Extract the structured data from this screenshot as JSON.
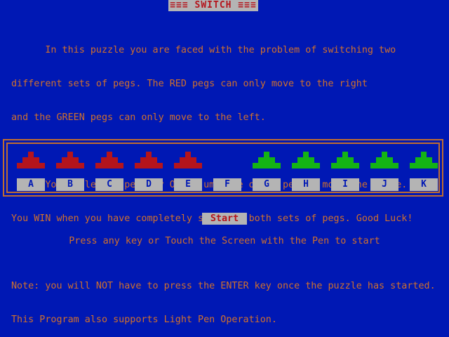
{
  "title": "≡≡≡ SWITCH ≡≡≡",
  "intro_lines": [
    "      In this puzzle you are faced with the problem of switching two",
    "different sets of pegs. The RED pegs can only move to the right",
    "and the GREEN pegs can only move to the left.",
    "",
    "      Your selected peg may ONLY jump one other peg OR move one Space.",
    "You WIN when you have completely switched both sets of pegs. Good Luck!",
    "",
    "Note: you will NOT have to press the ENTER key once the puzzle has started.",
    "This Program also supports Light Pen Operation."
  ],
  "board": {
    "slots": [
      {
        "label": "A",
        "peg": "red"
      },
      {
        "label": "B",
        "peg": "red"
      },
      {
        "label": "C",
        "peg": "red"
      },
      {
        "label": "D",
        "peg": "red"
      },
      {
        "label": "E",
        "peg": "red"
      },
      {
        "label": "F",
        "peg": "none"
      },
      {
        "label": "G",
        "peg": "green"
      },
      {
        "label": "H",
        "peg": "green"
      },
      {
        "label": "I",
        "peg": "green"
      },
      {
        "label": "J",
        "peg": "green"
      },
      {
        "label": "K",
        "peg": "green"
      }
    ]
  },
  "start_label": "Start",
  "prompt": "Press any key or Touch the Screen with the Pen to start",
  "colors": {
    "background": "#0018b4",
    "text": "#d0702c",
    "red_peg": "#b4141c",
    "green_peg": "#14b414",
    "label_bg": "#b4b4b4"
  }
}
